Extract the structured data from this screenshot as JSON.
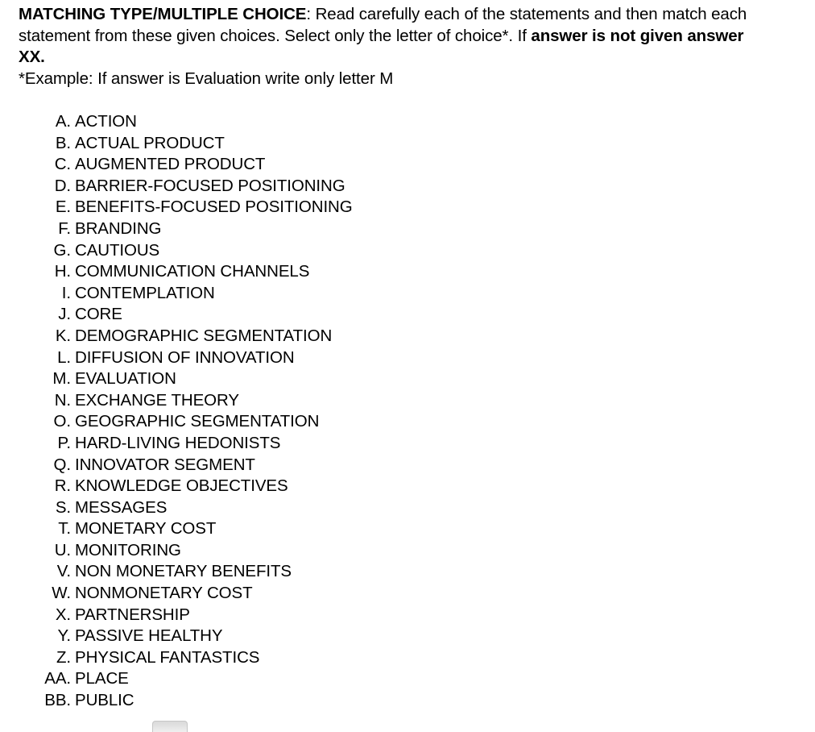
{
  "document": {
    "title": "MATCHING TYPE/MULTIPLE CHOICE",
    "instructions": {
      "heading_bold": "MATCHING TYPE/MULTIPLE CHOICE",
      "body_part_1": ": Read carefully each of the statements and then match each statement from these given choices. Select only the letter of choice*. If ",
      "body_bold_2": "answer is not given answer XX.",
      "example_note": "*Example: If answer is Evaluation write only letter M"
    },
    "choices": [
      {
        "marker": "A.",
        "label": "ACTION"
      },
      {
        "marker": "B.",
        "label": "ACTUAL PRODUCT"
      },
      {
        "marker": "C.",
        "label": "AUGMENTED PRODUCT"
      },
      {
        "marker": "D.",
        "label": "BARRIER-FOCUSED POSITIONING"
      },
      {
        "marker": "E.",
        "label": "BENEFITS-FOCUSED POSITIONING"
      },
      {
        "marker": "F.",
        "label": "BRANDING"
      },
      {
        "marker": "G.",
        "label": "CAUTIOUS"
      },
      {
        "marker": "H.",
        "label": "COMMUNICATION CHANNELS"
      },
      {
        "marker": "I.",
        "label": "CONTEMPLATION"
      },
      {
        "marker": "J.",
        "label": "CORE"
      },
      {
        "marker": "K.",
        "label": "DEMOGRAPHIC SEGMENTATION"
      },
      {
        "marker": "L.",
        "label": "DIFFUSION OF INNOVATION"
      },
      {
        "marker": "M.",
        "label": "EVALUATION"
      },
      {
        "marker": "N.",
        "label": "EXCHANGE THEORY"
      },
      {
        "marker": "O.",
        "label": "GEOGRAPHIC SEGMENTATION"
      },
      {
        "marker": "P.",
        "label": "HARD-LIVING HEDONISTS"
      },
      {
        "marker": "Q.",
        "label": "INNOVATOR SEGMENT"
      },
      {
        "marker": "R.",
        "label": "KNOWLEDGE OBJECTIVES"
      },
      {
        "marker": "S.",
        "label": "MESSAGES"
      },
      {
        "marker": "T.",
        "label": "MONETARY COST"
      },
      {
        "marker": "U.",
        "label": "MONITORING"
      },
      {
        "marker": "V.",
        "label": "NON MONETARY BENEFITS"
      },
      {
        "marker": "W.",
        "label": "NONMONETARY COST"
      },
      {
        "marker": "X.",
        "label": "PARTNERSHIP"
      },
      {
        "marker": "Y.",
        "label": "PASSIVE HEALTHY"
      },
      {
        "marker": "Z.",
        "label": "PHYSICAL FANTASTICS"
      },
      {
        "marker": "AA.",
        "label": "PLACE"
      },
      {
        "marker": "BB.",
        "label": "PUBLIC"
      }
    ]
  },
  "colors": {
    "text": "#000000",
    "background": "#ffffff",
    "artifact_grey": "#d9d9d9"
  }
}
